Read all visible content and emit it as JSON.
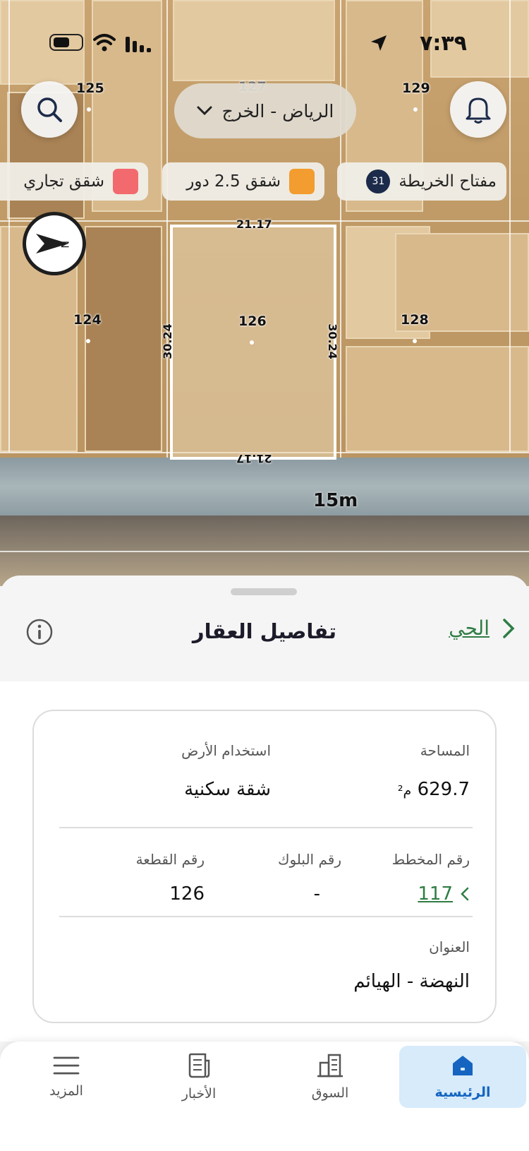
{
  "status_bar": {
    "time": "٧:٣٩"
  },
  "map": {
    "city_selector": "الرياض - الخرج",
    "legend": {
      "map_key_label": "مفتاح الخريطة",
      "map_key_count": "31",
      "apartments_2_5_floors": "شقق 2.5 دور",
      "commercial_apartments": "شقق تجاري"
    },
    "lots": [
      "125",
      "127",
      "129",
      "124",
      "126",
      "128"
    ],
    "dimensions": {
      "top": "21.17",
      "bottom": "21.17",
      "left": "30.24",
      "right": "30.24"
    },
    "street_width": "15m"
  },
  "colors": {
    "legend_orange": "#f39c2f",
    "legend_red": "#f26a6e",
    "accent_green": "#2f7d45",
    "active_tab_bg": "#d7ebfb",
    "active_tab_text": "#1565c0"
  },
  "sheet": {
    "title": "تفاصيل العقار",
    "back_label": "الحي",
    "fields": {
      "area_label": "المساحة",
      "area_value": "629.7",
      "area_unit": "م²",
      "land_use_label": "استخدام الأرض",
      "land_use_value": "شقة سكنية",
      "plan_label": "رقم المخطط",
      "plan_value": "117",
      "block_label": "رقم البلوك",
      "block_value": "-",
      "plot_label": "رقم القطعة",
      "plot_value": "126",
      "address_label": "العنوان",
      "address_value": "النهضة - الهيائم"
    }
  },
  "tabbar": {
    "home": "الرئيسية",
    "market": "السوق",
    "news": "الأخبار",
    "more": "المزيد"
  }
}
